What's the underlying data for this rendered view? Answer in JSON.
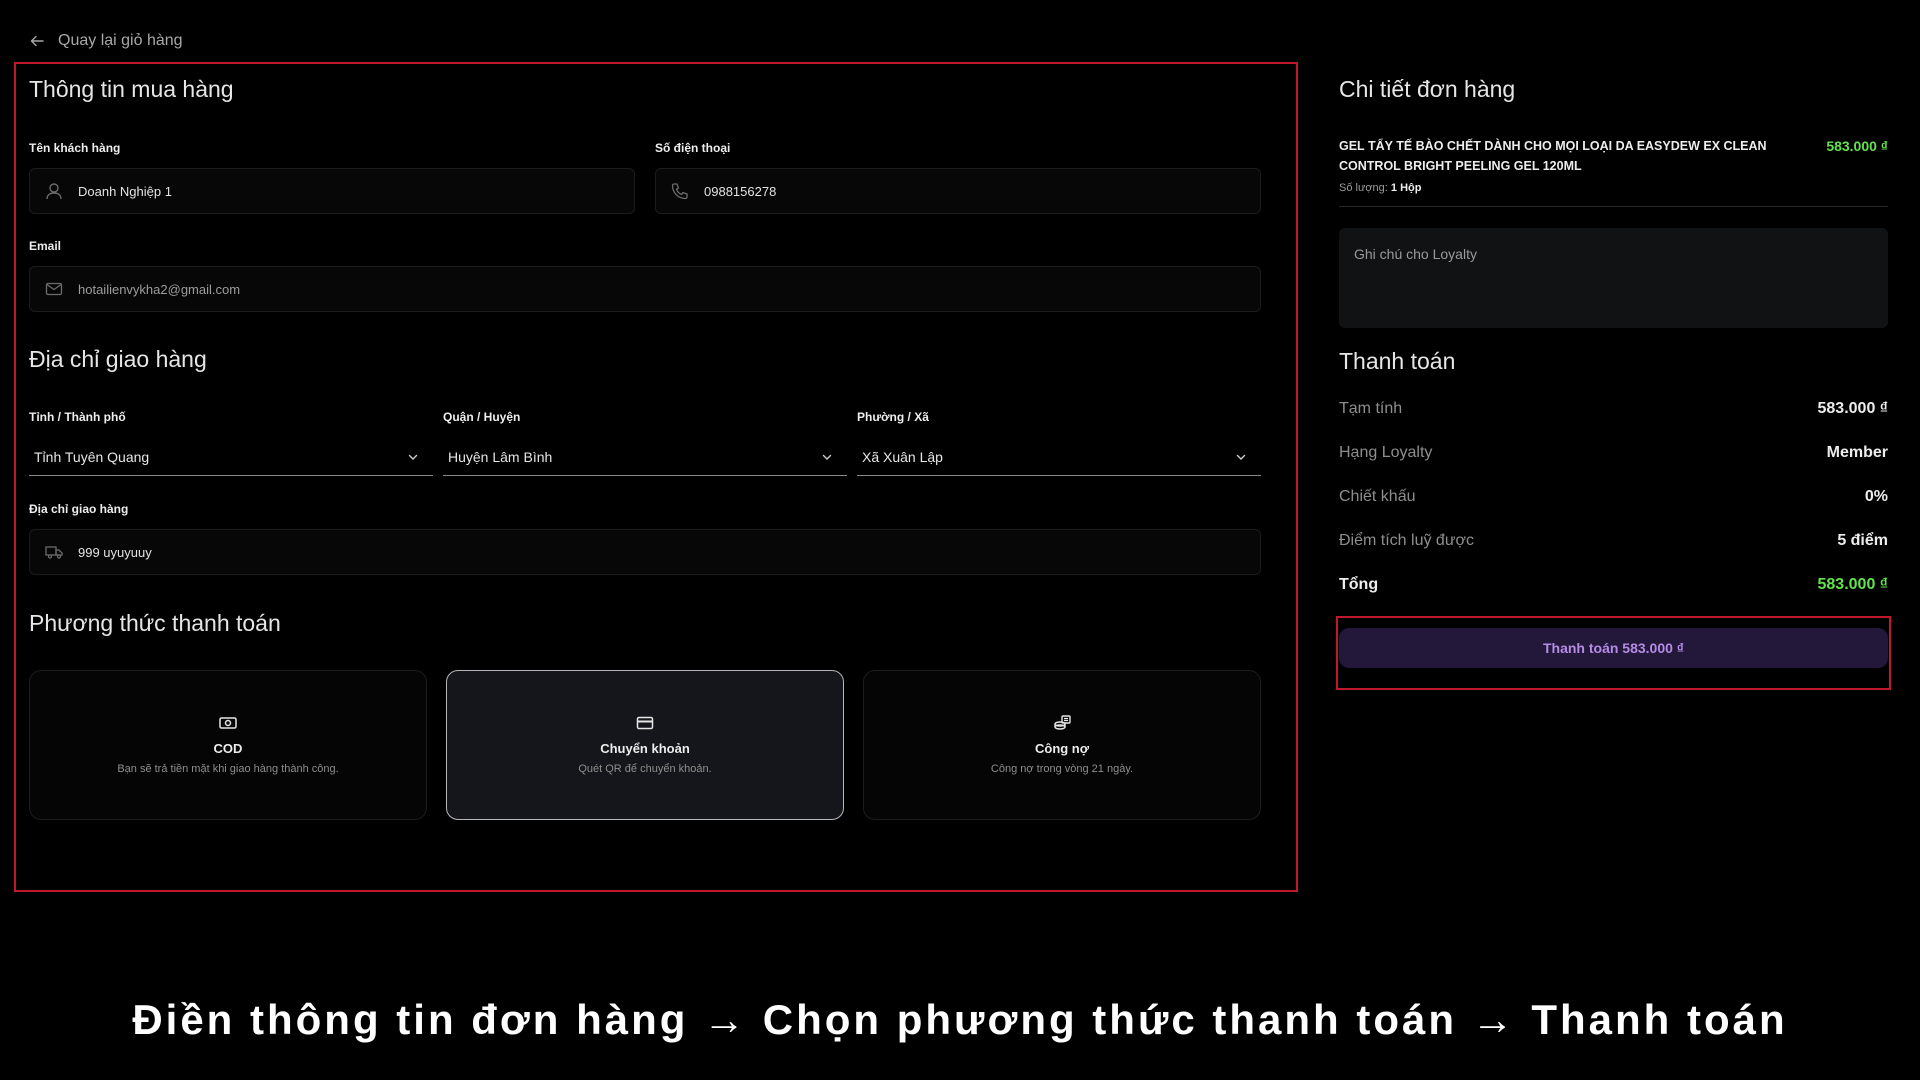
{
  "back": {
    "label": "Quay lại giỏ hàng"
  },
  "purchase": {
    "title": "Thông tin mua hàng",
    "customer_label": "Tên khách hàng",
    "customer_value": "Doanh Nghiệp 1",
    "phone_label": "Số điện thoại",
    "phone_value": "0988156278",
    "email_label": "Email",
    "email_value": "hotailienvykha2@gmail.com"
  },
  "shipping": {
    "title": "Địa chỉ giao hàng",
    "province_label": "Tỉnh / Thành phố",
    "province_value": "Tỉnh Tuyên Quang",
    "district_label": "Quận / Huyện",
    "district_value": "Huyện Lâm Bình",
    "ward_label": "Phường / Xã",
    "ward_value": "Xã Xuân Lập",
    "address_label": "Địa chỉ giao hàng",
    "address_value": "999 uyuyuuy"
  },
  "payment": {
    "title": "Phương thức thanh toán",
    "methods": [
      {
        "name": "COD",
        "desc": "Bạn sẽ trả tiền mặt khi giao hàng thành công.",
        "icon": "cash-icon"
      },
      {
        "name": "Chuyển khoản",
        "desc": "Quét QR để chuyển khoản.",
        "icon": "credit-card-icon",
        "selected": true
      },
      {
        "name": "Công nợ",
        "desc": "Công nợ trong vòng 21 ngày.",
        "icon": "coins-icon"
      }
    ]
  },
  "order": {
    "title": "Chi tiết đơn hàng",
    "product_name": "GEL TẨY TẾ BÀO CHẾT DÀNH CHO MỌI LOẠI DA EASYDEW EX CLEAN CONTROL BRIGHT PEELING GEL 120ML",
    "product_price": "583.000 ₫",
    "qty_label": "Số lượng:",
    "qty_value": "1 Hộp",
    "note_placeholder": "Ghi chú cho Loyalty"
  },
  "summary": {
    "title": "Thanh toán",
    "rows": [
      {
        "label": "Tạm tính",
        "value": "583.000 ₫"
      },
      {
        "label": "Hạng Loyalty",
        "value": "Member"
      },
      {
        "label": "Chiết khấu",
        "value": "0%"
      },
      {
        "label": "Điểm tích luỹ được",
        "value": "5 điểm"
      },
      {
        "label": "Tổng",
        "value": "583.000 ₫"
      }
    ],
    "pay_button": "Thanh toán 583.000 ₫"
  },
  "caption": "Điền thông tin đơn hàng → Chọn phương thức thanh toán → Thanh toán",
  "colors": {
    "accent_green": "#62e24d",
    "highlight_red": "#c0192b",
    "button_purple": "#b48ce6"
  }
}
